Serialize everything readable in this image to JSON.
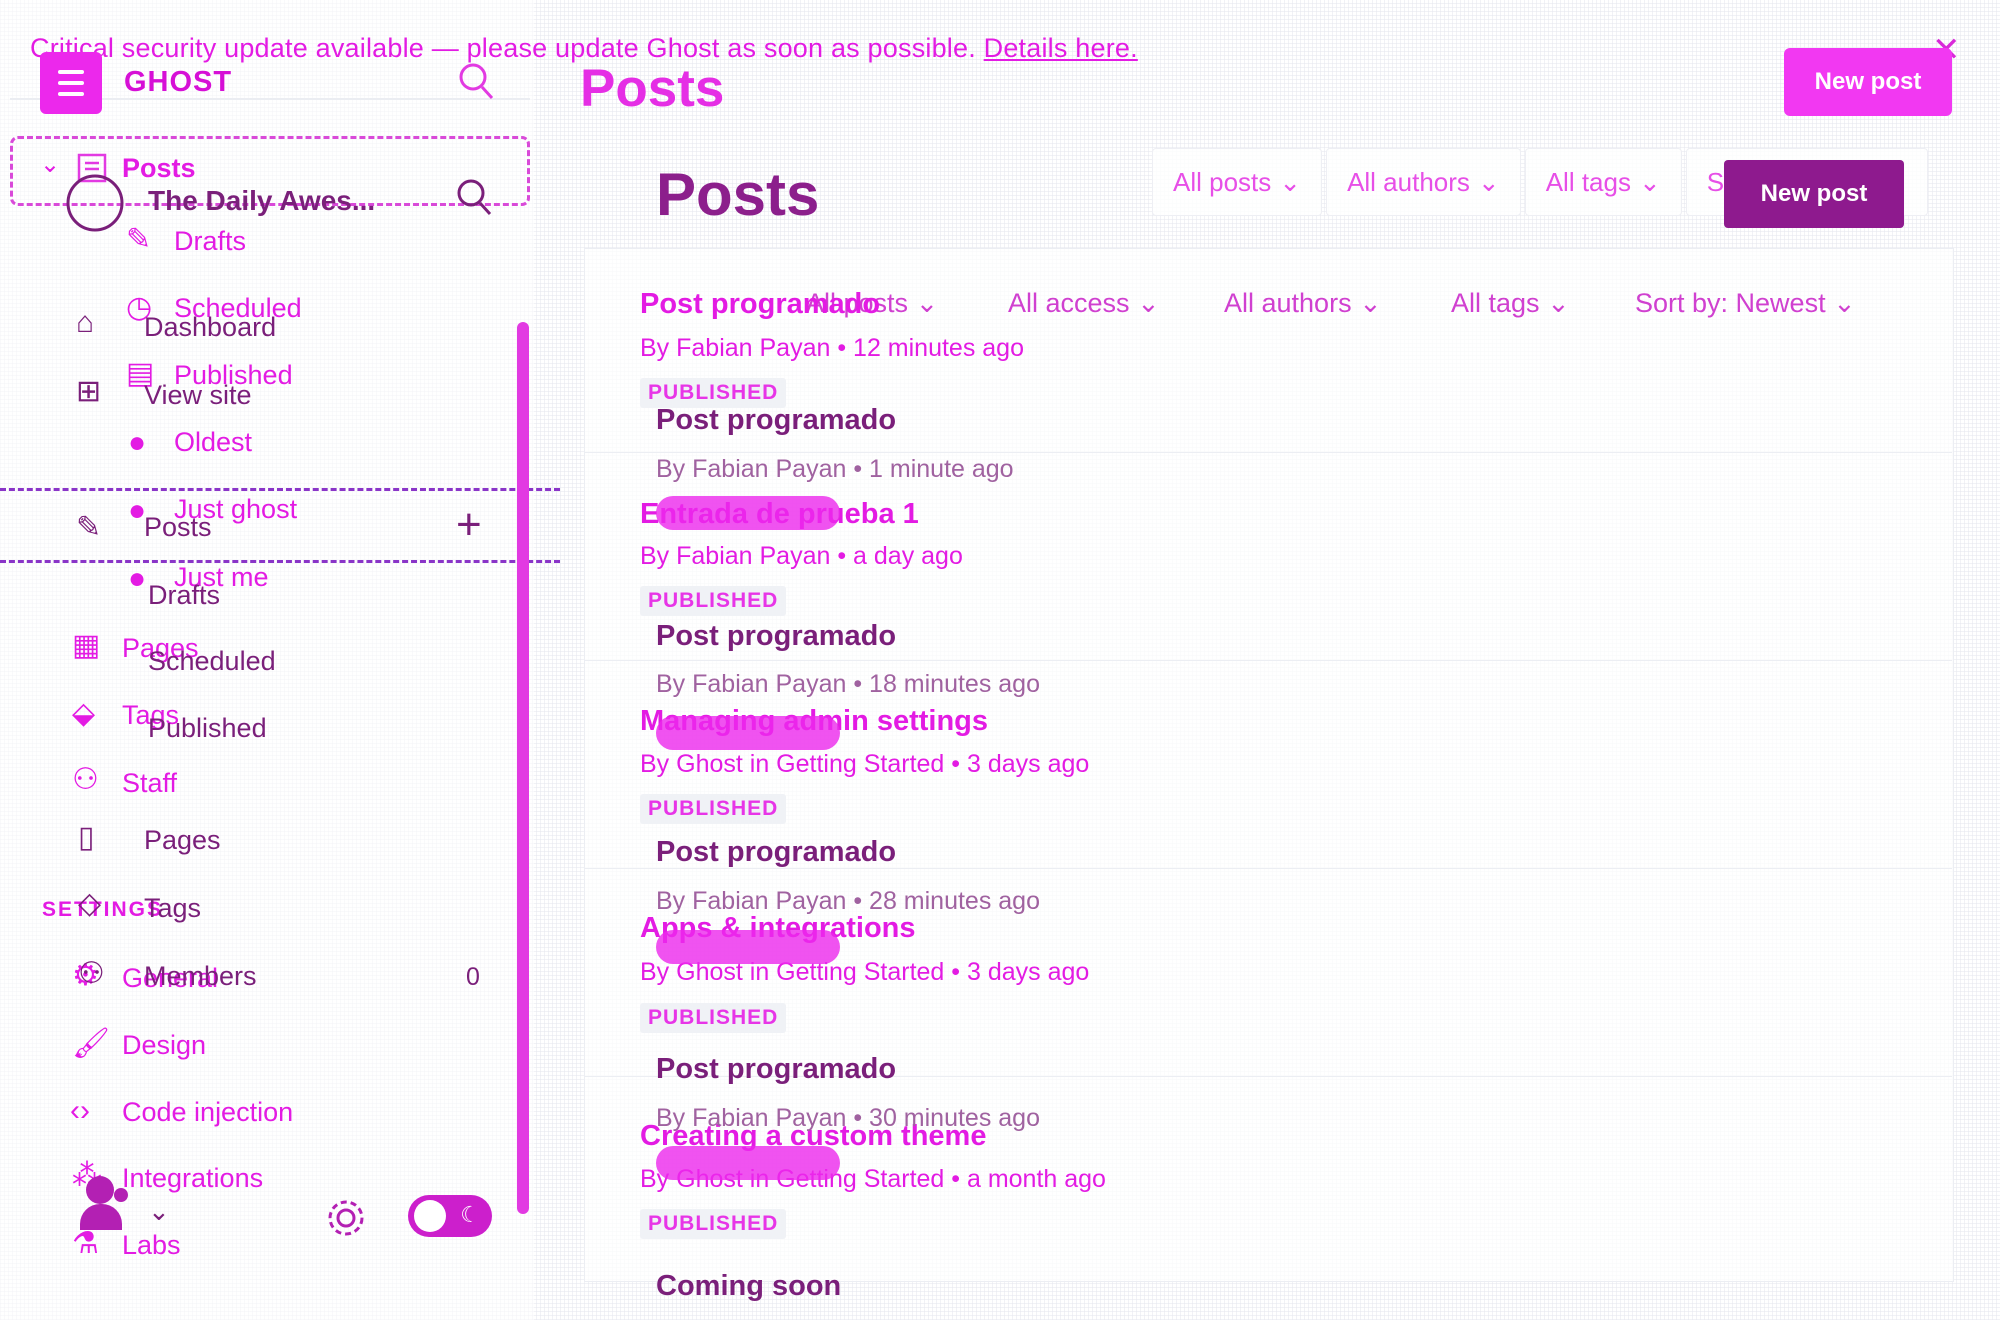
{
  "banner": {
    "text": "Critical security update available — please update Ghost as soon as possible.",
    "link": "Details here."
  },
  "brand": "GHOST",
  "site_name": "The Daily Awes...",
  "page_title": "Posts",
  "new_post_label": "New post",
  "nav_ghost": {
    "posts": "Posts",
    "drafts": "Drafts",
    "scheduled": "Scheduled",
    "published": "Published",
    "oldest": "Oldest",
    "just_ghost": "Just ghost",
    "just_me": "Just me",
    "pages": "Pages",
    "tags": "Tags",
    "staff": "Staff",
    "settings_header": "SETTINGS",
    "general": "General",
    "design": "Design",
    "code_injection": "Code injection",
    "integrations": "Integrations",
    "labs": "Labs"
  },
  "nav": {
    "dashboard": "Dashboard",
    "view_site": "View site",
    "posts": "Posts",
    "drafts": "Drafts",
    "scheduled": "Scheduled",
    "published": "Published",
    "pages": "Pages",
    "tags": "Tags",
    "members": "Members",
    "members_count": "0"
  },
  "top_filters": [
    "All posts",
    "All authors",
    "All tags",
    "S"
  ],
  "filters": [
    "All posts",
    "All access",
    "All authors",
    "All tags",
    "Sort by: Newest"
  ],
  "ghost_posts": [
    {
      "title": "Post programado",
      "meta": "By Fabian Payan • 12 minutes ago",
      "status": "PUBLISHED"
    },
    {
      "title": "Entrada de prueba 1",
      "meta": "By Fabian Payan • a day ago",
      "status": "PUBLISHED"
    },
    {
      "title": "Managing admin settings",
      "meta": "By Ghost in Getting Started • 3 days ago",
      "status": "PUBLISHED"
    },
    {
      "title": "Apps & integrations",
      "meta": "By Ghost in Getting Started • 3 days ago",
      "status": "PUBLISHED"
    },
    {
      "title": "Creating a custom theme",
      "meta": "By Ghost in Getting Started • a month ago",
      "status": "PUBLISHED"
    }
  ],
  "posts": [
    {
      "title": "Post programado",
      "meta": "By Fabian Payan • 1 minute ago"
    },
    {
      "title": "Post programado",
      "meta": "By Fabian Payan • 18 minutes ago"
    },
    {
      "title": "Post programado",
      "meta": "By Fabian Payan • 28 minutes ago"
    },
    {
      "title": "Post programado",
      "meta": "By Fabian Payan • 30 minutes ago"
    },
    {
      "title": "Coming soon",
      "meta": ""
    }
  ],
  "colors": {
    "accent": "#e31be3",
    "dark": "#7a1f7a"
  }
}
